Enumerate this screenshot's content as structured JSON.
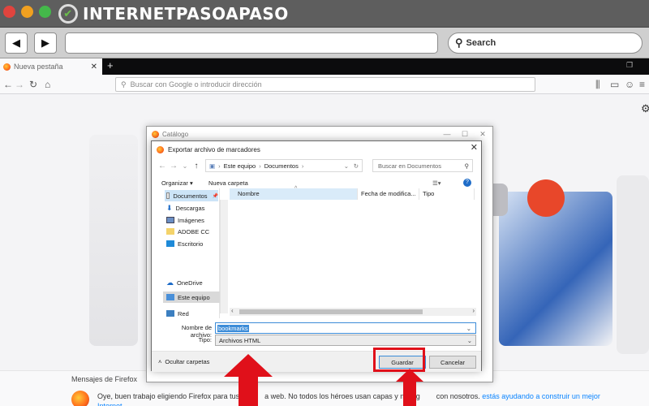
{
  "brand": {
    "text": "INTERNETPASOAPASO"
  },
  "navbar": {
    "search_label": "Search"
  },
  "firefox": {
    "tab_label": "Nueva pestaña",
    "address_placeholder": "Buscar con Google o introducir dirección"
  },
  "catalog": {
    "title": "Catálogo"
  },
  "dialog": {
    "title": "Exportar archivo de marcadores",
    "breadcrumb": [
      "Este equipo",
      "Documentos"
    ],
    "search_placeholder": "Buscar en Documentos",
    "toolbar": {
      "organize": "Organizar",
      "new_folder": "Nueva carpeta"
    },
    "nav_items": [
      "Documentos",
      "Descargas",
      "Imágenes",
      "ADOBE CC",
      "Escritorio",
      "OneDrive",
      "Este equipo",
      "Red"
    ],
    "columns": [
      "Nombre",
      "Fecha de modifica...",
      "Tipo"
    ],
    "filename_label": "Nombre de archivo:",
    "filename_value": "bookmarks",
    "type_label": "Tipo:",
    "type_value": "Archivos HTML",
    "hide_folders": "Ocultar carpetas",
    "save": "Guardar",
    "cancel": "Cancelar"
  },
  "messages": {
    "title": "Mensajes de Firefox",
    "text_before": "Oye, buen trabajo eligiendo Firefox para tus vi",
    "text_mid": "a web. No todos los héroes usan capas y naveg",
    "text_after": "con nosotros.",
    "link": "estás ayudando a construir un mejor Internet."
  },
  "colors": {
    "highlight": "#e0101a",
    "accent": "#3c8cd8",
    "brand_green": "#6ac04a"
  }
}
